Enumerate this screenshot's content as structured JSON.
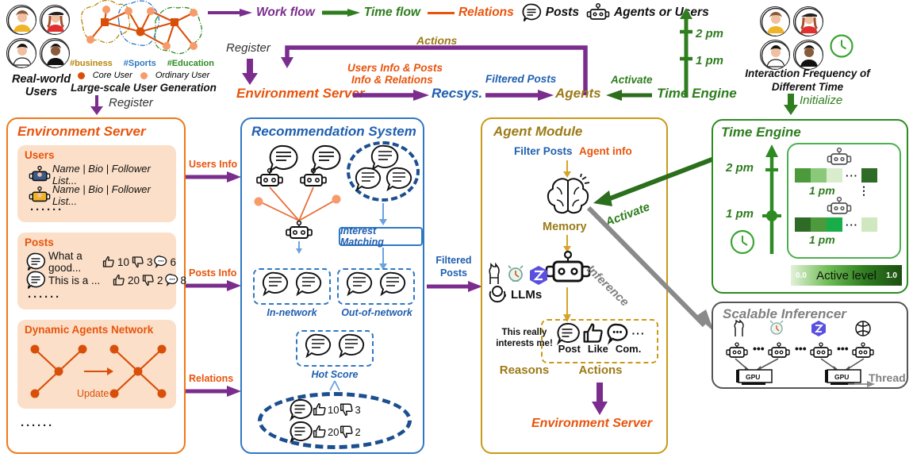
{
  "legend": {
    "items": [
      {
        "label": "Work flow",
        "icon": "purple-arrow-icon",
        "color": "#7b2d8e"
      },
      {
        "label": "Time flow",
        "icon": "green-arrow-icon",
        "color": "#2e7d1e"
      },
      {
        "label": "Relations",
        "icon": "orange-line-icon",
        "color": "#e8540c"
      },
      {
        "label": "Posts",
        "icon": "post-bubble-icon",
        "color": "#111111"
      },
      {
        "label": "Agents or Users",
        "icon": "robot-icon",
        "color": "#111111"
      }
    ]
  },
  "topleft": {
    "real_world_users": "Real-world\nUsers",
    "real_world_users_line1": "Real-world",
    "real_world_users_line2": "Users",
    "graph_title": "Large-scale User Generation",
    "tags": [
      {
        "label": "#business",
        "color": "#b8860b"
      },
      {
        "label": "#Sports",
        "color": "#2f78c4"
      },
      {
        "label": "#Education",
        "color": "#2e8b22"
      }
    ],
    "node_legend": [
      {
        "label": "Core User",
        "color": "#d94f0a"
      },
      {
        "label": "Ordinary User",
        "color": "#f79b6a"
      }
    ],
    "register_label": "Register"
  },
  "topflow": {
    "register_label": "Register",
    "actions_label": "Actions",
    "users_info_posts": "Users Info & Posts",
    "info_relations": "Info & Relations",
    "filtered_posts": "Filtered Posts",
    "activate_label": "Activate",
    "nodes": [
      {
        "label": "Environment Server",
        "color": "#e8540c"
      },
      {
        "label": "Recsys.",
        "color": "#1f5fb0"
      },
      {
        "label": "Agents",
        "color": "#9c7a16"
      },
      {
        "label": "Time Engine",
        "color": "#2e7d1e"
      }
    ],
    "time_ticks": [
      "2 pm",
      "1 pm"
    ]
  },
  "topright": {
    "title_line1": "Interaction Frequency of",
    "title_line2": "Different Time",
    "initialize_label": "Initialize",
    "clock_icon": "clock-icon"
  },
  "env_panel": {
    "title": "Environment Server",
    "users": {
      "heading": "Users",
      "rows": [
        "Name | Bio | Follower List...",
        "Name | Bio | Follower List..."
      ],
      "ellipsis": "······"
    },
    "posts": {
      "heading": "Posts",
      "rows": [
        {
          "text": "What a good...",
          "likes": "10",
          "dislikes": "3",
          "comments": "6"
        },
        {
          "text": "This is a ...",
          "likes": "20",
          "dislikes": "2",
          "comments": "8"
        }
      ],
      "ellipsis": "······"
    },
    "network": {
      "heading": "Dynamic Agents Network",
      "update_label": "Update"
    },
    "ellipsis": "······"
  },
  "connectors": {
    "users_info": "Users Info",
    "posts_info": "Posts Info",
    "relations": "Relations",
    "filtered_posts_line1": "Filtered",
    "filtered_posts_line2": "Posts"
  },
  "rec_panel": {
    "title": "Recommendation System",
    "interest_matching": "Interest Matching",
    "in_network": "In-network",
    "out_of_network": "Out-of-network",
    "hot_score": "Hot Score",
    "hot_rows": [
      {
        "likes": "10",
        "dislikes": "3"
      },
      {
        "likes": "20",
        "dislikes": "2"
      }
    ]
  },
  "agent_panel": {
    "title": "Agent Module",
    "filter_posts": "Filter Posts",
    "agent_info": "Agent info",
    "memory": "Memory",
    "llms": "LLMs",
    "llm_icons": [
      "llama-icon",
      "vicuna-icon",
      "zhipu-icon",
      "openai-icon"
    ],
    "reasons_text_line1": "This really",
    "reasons_text_line2": "interests me!",
    "reasons_label": "Reasons",
    "actions_label": "Actions",
    "actions": [
      "Post",
      "Like",
      "Com."
    ],
    "actions_more": "···",
    "output_label": "Environment Server",
    "activate_label": "Activate",
    "inference_label": "Inference"
  },
  "time_panel": {
    "title": "Time Engine",
    "ticks": [
      "2 pm",
      "1 pm"
    ],
    "rows": [
      {
        "time_label": "1 pm",
        "cells": [
          0.72,
          0.45,
          0.18,
          0.95
        ]
      },
      {
        "time_label": "1 pm",
        "cells": [
          0.95,
          0.72,
          0.85,
          0.22
        ]
      }
    ],
    "row_separator": "⋮",
    "ellipsis": "···",
    "colorbar": {
      "min": "0.0",
      "max": "1.0",
      "label": "Active level"
    },
    "clock_icon": "clock-icon"
  },
  "inf_panel": {
    "title": "Scalable Inferencer",
    "gpu_label": "GPU",
    "thread_label": "Thread",
    "ellipsis": "···",
    "model_icons": [
      "llama-icon",
      "vicuna-icon",
      "zhipu-icon",
      "openai-icon"
    ]
  },
  "colors": {
    "purple": "#7b2d8e",
    "green": "#2e7d1e",
    "orange": "#e8540c",
    "blue": "#1f5fb0",
    "gold": "#9c7a16",
    "gray": "#808080",
    "panel_env": "#f07818",
    "panel_rec": "#2f78c4",
    "panel_agent": "#c99a18",
    "panel_time": "#2e8b22",
    "panel_inf": "#555555",
    "subbox_bg": "#fbdfc8"
  }
}
